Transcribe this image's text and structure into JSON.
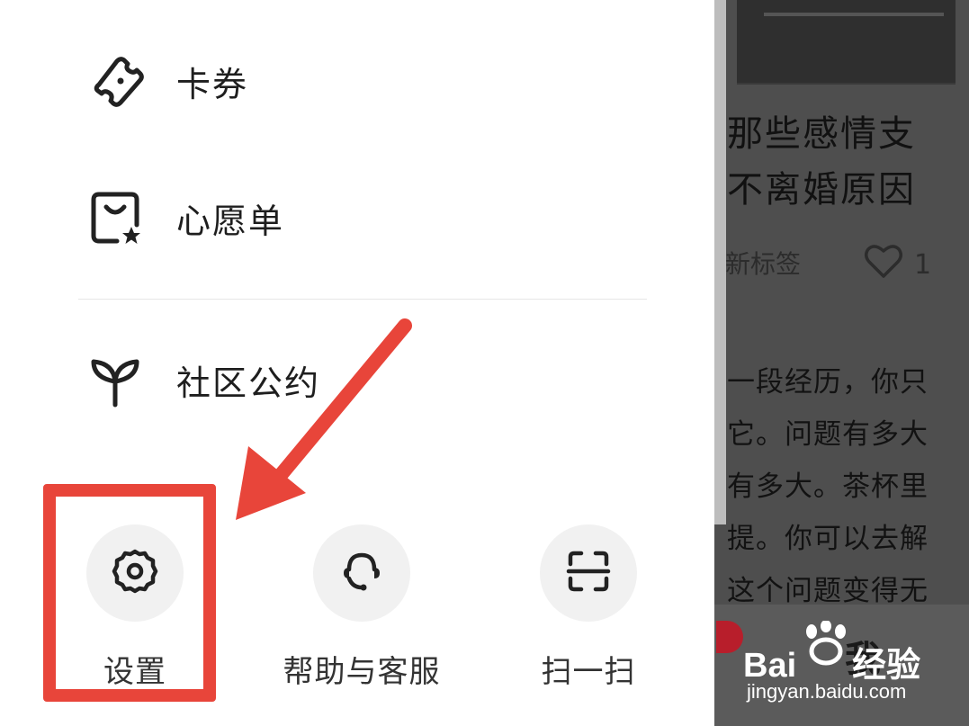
{
  "drawer": {
    "items": [
      {
        "label": "卡券",
        "icon": "ticket-icon"
      },
      {
        "label": "心愿单",
        "icon": "wishlist-bag-icon"
      },
      {
        "label": "社区公约",
        "icon": "sprout-icon"
      }
    ],
    "bottom_actions": [
      {
        "label": "设置",
        "icon": "gear-icon"
      },
      {
        "label": "帮助与客服",
        "icon": "headset-icon"
      },
      {
        "label": "扫一扫",
        "icon": "scan-icon"
      }
    ]
  },
  "article": {
    "title_line1": "那些感情支",
    "title_line2": "不离婚原因",
    "tag": "新标签",
    "like_count": "1",
    "body_lines": [
      "一段经历，你只",
      "它。问题有多大",
      "有多大。茶杯里",
      "提。你可以去解",
      "这个问题变得无"
    ],
    "bottom_word": "我"
  },
  "watermark": {
    "brand": "Bai",
    "brand_suffix": "经验",
    "url": "jingyan.baidu.com"
  },
  "colors": {
    "annotation_red": "#e8453a",
    "icon_dark": "#222222",
    "overlay": "#4e4e4e"
  }
}
